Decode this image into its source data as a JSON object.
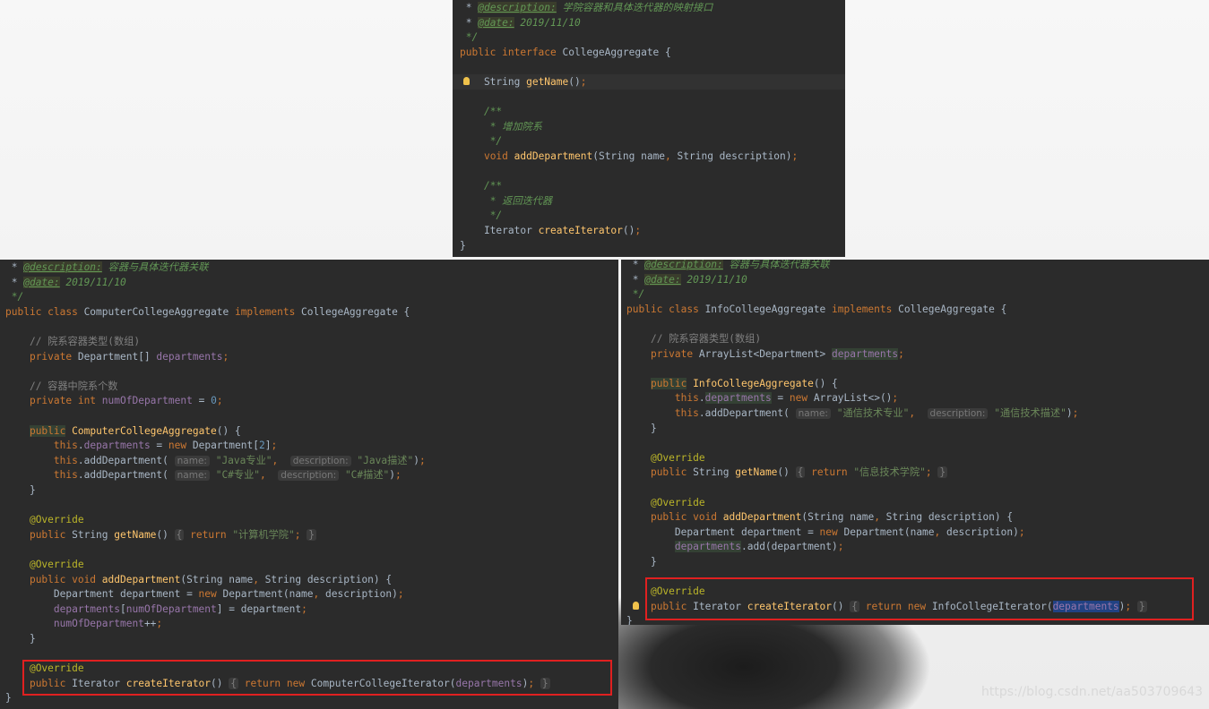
{
  "top_panel": {
    "lines": [
      " * <span class=\"doctag\">@description:</span><span class=\"doc\"> 学院容器和具体迭代器的映射接口</span>",
      " * <span class=\"doctag\">@date:</span><span class=\"doc\"> 2019/11/10</span>",
      " <span class=\"doc\">*/</span>",
      "<span class=\"kw\">public interface</span> CollegeAggregate {",
      "",
      "    String <span class=\"fn\">getName</span>()<span class=\"kw\">;</span>",
      "",
      "    <span class=\"doc\">/**</span>",
      "     <span class=\"doc\">* 增加院系</span>",
      "     <span class=\"doc\">*/</span>",
      "    <span class=\"kw\">void</span> <span class=\"fn\">addDepartment</span>(String name<span class=\"kw\">,</span> String description)<span class=\"kw\">;</span>",
      "",
      "    <span class=\"doc\">/**</span>",
      "     <span class=\"doc\">* 返回迭代器</span>",
      "     <span class=\"doc\">*/</span>",
      "    Iterator <span class=\"fn\">createIterator</span>()<span class=\"kw\">;</span>",
      "}"
    ]
  },
  "left_panel": {
    "lines": [
      " * <span class=\"doctag\">@description:</span><span class=\"doc\"> 容器与具体迭代器关联</span>",
      " * <span class=\"doctag\">@date:</span><span class=\"doc\"> 2019/11/10</span>",
      " <span class=\"doc\">*/</span>",
      "<span class=\"kw\">public class</span> ComputerCollegeAggregate <span class=\"kw\">implements</span> CollegeAggregate {",
      "",
      "    <span class=\"cmt\">// 院系容器类型(数组)</span>",
      "    <span class=\"kw\">private</span> Department[] <span class=\"field\">departments</span><span class=\"kw\">;</span>",
      "",
      "    <span class=\"cmt\">// 容器中院系个数</span>",
      "    <span class=\"kw\">private int</span> <span class=\"field\">numOfDepartment</span> = <span class=\"num\">0</span><span class=\"kw\">;</span>",
      "",
      "    <span class=\"kw hlbg\">public</span> <span class=\"fn\">ComputerCollegeAggregate</span>() {",
      "        <span class=\"kw\">this</span>.<span class=\"field\">departments</span> = <span class=\"kw\">new</span> Department[<span class=\"num\">2</span>]<span class=\"kw\">;</span>",
      "        <span class=\"kw\">this</span>.addDepartment( <span class=\"hint\">name:</span> <span class=\"str\">\"Java专业\"</span><span class=\"kw\">,</span>  <span class=\"hint\">description:</span> <span class=\"str\">\"Java描述\"</span>)<span class=\"kw\">;</span>",
      "        <span class=\"kw\">this</span>.addDepartment( <span class=\"hint\">name:</span> <span class=\"str\">\"C#专业\"</span><span class=\"kw\">,</span>  <span class=\"hint\">description:</span> <span class=\"str\">\"C#描述\"</span>)<span class=\"kw\">;</span>",
      "    }",
      "",
      "    <span class=\"ann\">@Override</span>",
      "    <span class=\"kw\">public</span> String <span class=\"fn\">getName</span>() <span class=\"fold\">{</span> <span class=\"kw\">return</span> <span class=\"str\">\"计算机学院\"</span><span class=\"kw\">;</span> <span class=\"fold\">}</span>",
      "",
      "    <span class=\"ann\">@Override</span>",
      "    <span class=\"kw\">public void</span> <span class=\"fn\">addDepartment</span>(String name<span class=\"kw\">,</span> String description) {",
      "        Department department = <span class=\"kw\">new</span> Department(name<span class=\"kw\">,</span> description)<span class=\"kw\">;</span>",
      "        <span class=\"field\">departments</span>[<span class=\"field\">numOfDepartment</span>] = department<span class=\"kw\">;</span>",
      "        <span class=\"field\">numOfDepartment</span>++<span class=\"kw\">;</span>",
      "    }",
      "",
      "    <span class=\"ann\">@Override</span>",
      "    <span class=\"kw\">public</span> Iterator <span class=\"fn\">createIterator</span>() <span class=\"fold\">{</span> <span class=\"kw\">return new</span> ComputerCollegeIterator(<span class=\"field\">departments</span>)<span class=\"kw\">;</span> <span class=\"fold\">}</span>",
      "}"
    ]
  },
  "right_panel": {
    "lines": [
      " * <span class=\"doctag\">@description:</span><span class=\"doc\"> 容器与具体迭代器关联</span>",
      " * <span class=\"doctag\">@date:</span><span class=\"doc\"> 2019/11/10</span>",
      " <span class=\"doc\">*/</span>",
      "<span class=\"kw\">public class</span> InfoCollegeAggregate <span class=\"kw\">implements</span> CollegeAggregate {",
      "",
      "    <span class=\"cmt\">// 院系容器类型(数组)</span>",
      "    <span class=\"kw\">private</span> ArrayList&lt;Department&gt; <span class=\"field hlbg\">departments</span><span class=\"kw\">;</span>",
      "",
      "    <span class=\"kw hlbg\">public</span> <span class=\"fn\">InfoCollegeAggregate</span>() {",
      "        <span class=\"kw\">this</span>.<span class=\"field hlbg\">departments</span> = <span class=\"kw\">new</span> ArrayList&lt;&gt;()<span class=\"kw\">;</span>",
      "        <span class=\"kw\">this</span>.addDepartment( <span class=\"hint\">name:</span> <span class=\"str\">\"通信技术专业\"</span><span class=\"kw\">,</span>  <span class=\"hint\">description:</span> <span class=\"str\">\"通信技术描述\"</span>)<span class=\"kw\">;</span>",
      "    }",
      "",
      "    <span class=\"ann\">@Override</span>",
      "    <span class=\"kw\">public</span> String <span class=\"fn\">getName</span>() <span class=\"fold\">{</span> <span class=\"kw\">return</span> <span class=\"str\">\"信息技术学院\"</span><span class=\"kw\">;</span> <span class=\"fold\">}</span>",
      "",
      "    <span class=\"ann\">@Override</span>",
      "    <span class=\"kw\">public void</span> <span class=\"fn\">addDepartment</span>(String name<span class=\"kw\">,</span> String description) {",
      "        Department department = <span class=\"kw\">new</span> Department(name<span class=\"kw\">,</span> description)<span class=\"kw\">;</span>",
      "        <span class=\"field hlbg\">departments</span>.add(department)<span class=\"kw\">;</span>",
      "    }",
      "",
      "    <span class=\"ann\">@Override</span>",
      "    <span class=\"kw\">public</span> Iterator <span class=\"fn\">createIterator</span>() <span class=\"fold\">{</span> <span class=\"kw\">return new</span> InfoCollegeIterator(<span class=\"field selbg\">departments</span>)<span class=\"kw\">;</span> <span class=\"fold\">}</span>",
      "}"
    ]
  },
  "watermark": "https://blog.csdn.net/aa503709643"
}
